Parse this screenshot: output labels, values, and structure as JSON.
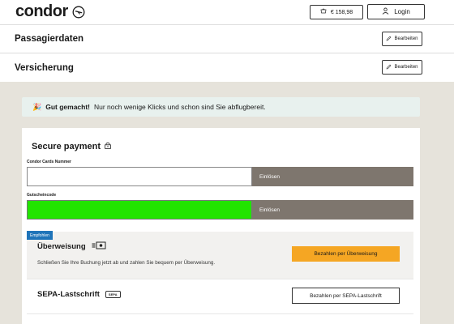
{
  "header": {
    "logo_text": "condor",
    "cart_total": "€ 158,98",
    "login_label": "Login"
  },
  "sections": [
    {
      "title": "Passagierdaten",
      "edit_label": "Bearbeiten"
    },
    {
      "title": "Versicherung",
      "edit_label": "Bearbeiten"
    }
  ],
  "alert": {
    "icon": "party-popper-icon",
    "bold_text": "Gut gemacht!",
    "text": "Nur noch wenige Klicks und schon sind Sie abflugbereit."
  },
  "payment": {
    "title": "Secure payment",
    "card_number_label": "Condor Cards Nummer",
    "card_number_value": "",
    "card_redeem_label": "Einlösen",
    "voucher_label": "Gutscheincode",
    "voucher_value": "",
    "voucher_redeem_label": "Einlösen",
    "methods": [
      {
        "badge": "Empfohlen",
        "name": "Überweisung",
        "description": "Schließen Sie Ihre Buchung jetzt ab und zahlen Sie bequem per Überweisung.",
        "button_label": "Bezahlen per Überweisung",
        "accent": "#f5a623"
      },
      {
        "name": "SEPA-Lastschrift",
        "icon_text": "SEPA",
        "button_label": "Bezahlen per SEPA-Lastschrift"
      }
    ]
  },
  "colors": {
    "background": "#e6e3db",
    "alert_bg": "#e8f1ee",
    "redeem_bg": "#7e766e",
    "badge_bg": "#1f74b9",
    "voucher_input_fill": "#22e400"
  }
}
